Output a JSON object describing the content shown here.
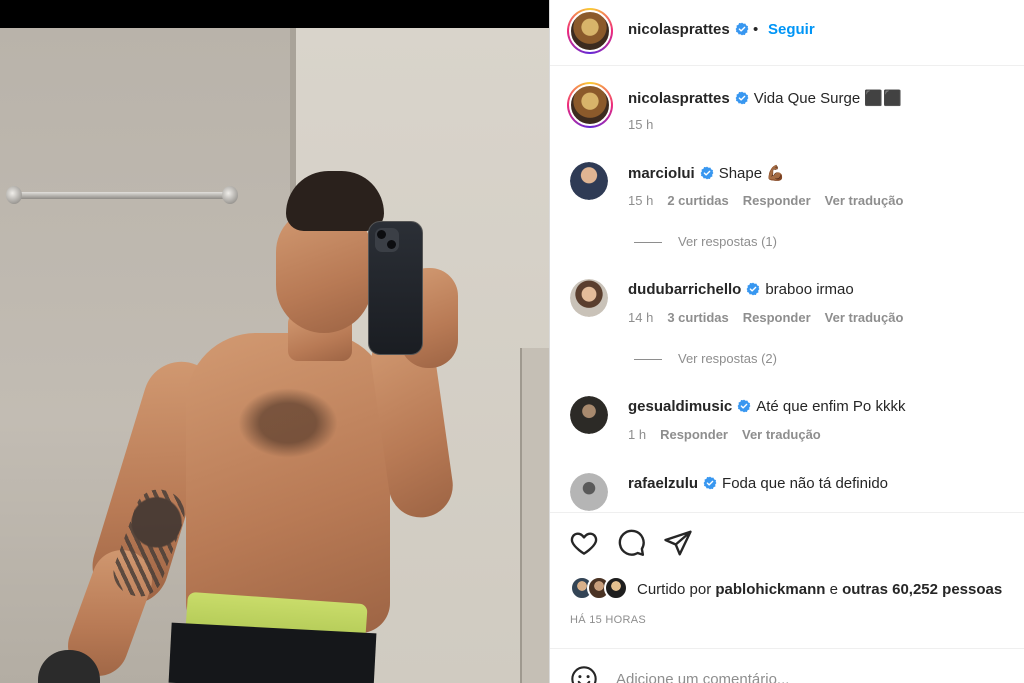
{
  "post": {
    "author": "nicolasprattes",
    "follow_label": "Seguir",
    "separator": "•",
    "caption": "Vida Que Surge ⬛⬛",
    "caption_time": "15 h"
  },
  "comments": [
    {
      "user": "marciolui",
      "text": "Shape 💪🏾",
      "time": "15 h",
      "likes": "2 curtidas",
      "reply": "Responder",
      "translate": "Ver tradução",
      "view_replies": "Ver respostas (1)",
      "avatar_color": "#3b4a6b"
    },
    {
      "user": "dudubarrichello",
      "text": "braboo irmao",
      "time": "14 h",
      "likes": "3 curtidas",
      "reply": "Responder",
      "translate": "Ver tradução",
      "view_replies": "Ver respostas (2)",
      "avatar_color": "#7a5a43"
    },
    {
      "user": "gesualdimusic",
      "text": "Até que enfim Po kkkk",
      "time": "1 h",
      "reply": "Responder",
      "translate": "Ver tradução",
      "avatar_color": "#3a3a35"
    },
    {
      "user": "rafaelzulu",
      "text": "Foda que não tá definido",
      "avatar_color": "#9a9a9a"
    }
  ],
  "likes": {
    "prefix": "Curtido por",
    "user": "pablohickmann",
    "connector": "e",
    "others": "outras 60,252 pessoas"
  },
  "time_ago": "HÁ 15 HORAS",
  "add_comment": {
    "placeholder": "Adicione um comentário..."
  },
  "icons": [
    "heart-icon",
    "comment-icon",
    "share-icon",
    "emoji-icon",
    "verified-icon"
  ],
  "colors": {
    "accent": "#0095f6",
    "verified": "#3897f0",
    "text": "#262626",
    "muted": "#8e8e8e"
  }
}
